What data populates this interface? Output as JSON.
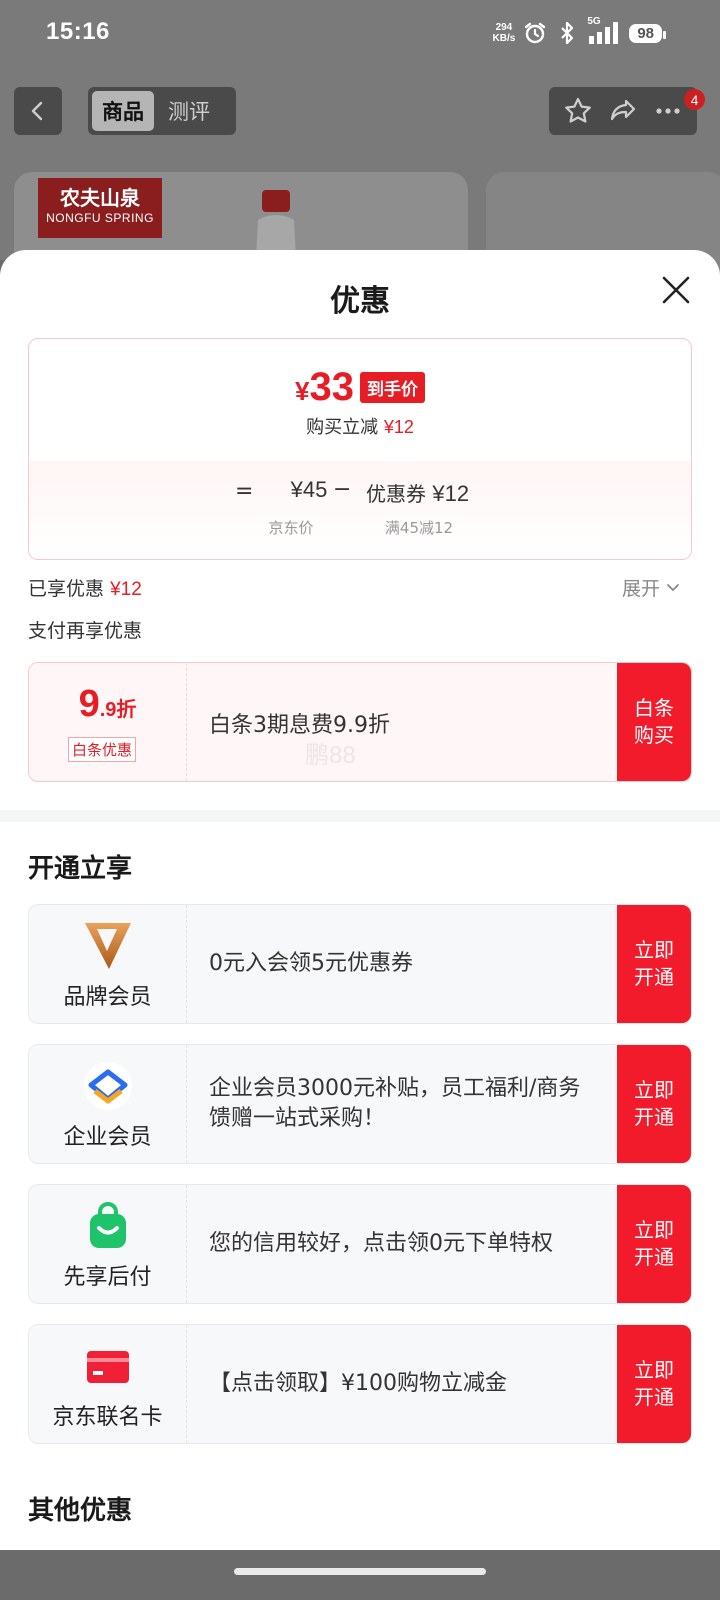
{
  "status_bar": {
    "time": "15:16",
    "net_speed_value": "294",
    "net_speed_unit": "KB/s",
    "signal_label": "5G",
    "battery": "98",
    "icons": [
      "alarm-icon",
      "bluetooth-icon",
      "signal-icon",
      "battery-icon"
    ]
  },
  "nav": {
    "tabs": [
      "商品",
      "测评"
    ],
    "active_tab": "商品",
    "cart_count": "4",
    "icons": [
      "back-icon",
      "star-icon",
      "share-icon",
      "more-icon"
    ]
  },
  "product": {
    "brand_cn": "农夫山泉",
    "brand_en": "NONGFU SPRING"
  },
  "sheet": {
    "title": "优惠",
    "price_card": {
      "final_yen": "¥",
      "final_price": "33",
      "final_tag": "到手价",
      "reduce_label": "购买立减",
      "reduce_amount": "¥12",
      "equals": "=",
      "base_price": "¥45",
      "minus": "−",
      "coupon_label": "优惠券",
      "coupon_value": "¥12",
      "base_caption": "京东价",
      "coupon_caption": "满45减12"
    },
    "enjoyed_label": "已享优惠",
    "enjoyed_amount": "¥12",
    "expand_label": "展开",
    "pay_more_label": "支付再享优惠",
    "baitiao": {
      "discount_big": "9",
      "discount_small": ".9",
      "discount_unit": "折",
      "tag": "白条优惠",
      "text": "白条3期息费9.9折",
      "watermark": "鹏88",
      "button": "白条购买"
    },
    "open_section_title": "开通立享",
    "offers": [
      {
        "name": "品牌会员",
        "desc": "0元入会领5元优惠券",
        "button": "立即开通",
        "icon": "brand-member-icon"
      },
      {
        "name": "企业会员",
        "desc": "企业会员3000元补贴，员工福利/商务馈赠一站式采购！",
        "button": "立即开通",
        "icon": "enterprise-member-icon"
      },
      {
        "name": "先享后付",
        "desc": "您的信用较好，点击领0元下单特权",
        "button": "立即开通",
        "icon": "pay-later-bag-icon"
      },
      {
        "name": "京东联名卡",
        "desc": "【点击领取】¥100购物立减金",
        "button": "立即开通",
        "icon": "co-brand-card-icon"
      }
    ],
    "other_section_title": "其他优惠"
  },
  "colors": {
    "accent": "#e81c25",
    "button_red": "#f21b2b",
    "overlay": "#7a7a7a"
  }
}
